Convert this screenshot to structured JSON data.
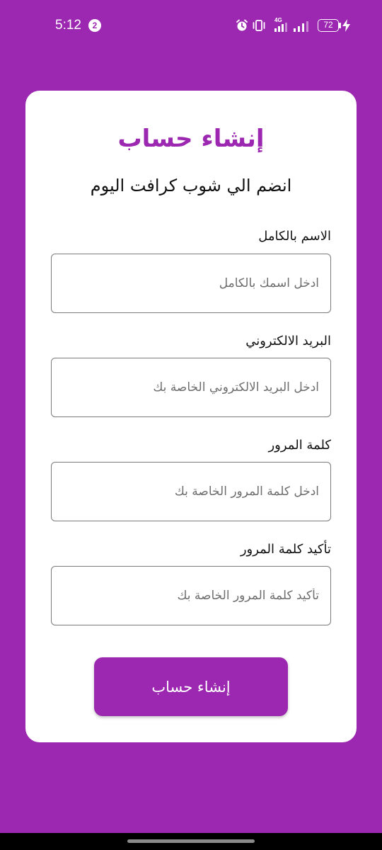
{
  "status_bar": {
    "time": "5:12",
    "notification_count": "2",
    "network_type": "4G",
    "battery_level": "72",
    "icons": [
      "alarm-icon",
      "vibrate-icon",
      "signal-icon",
      "signal-icon",
      "battery-icon",
      "charging-icon"
    ]
  },
  "colors": {
    "background": "#9c27b0",
    "accent": "#9c27b0",
    "card": "#ffffff"
  },
  "form": {
    "title": "إنشاء حساب",
    "subtitle": "انضم الي شوب كرافت اليوم",
    "fields": [
      {
        "label": "الاسم بالكامل",
        "placeholder": "ادخل اسمك بالكامل",
        "value": ""
      },
      {
        "label": "البريد الالكتروني",
        "placeholder": "ادخل البريد الالكتروني الخاصة بك",
        "value": ""
      },
      {
        "label": "كلمة المرور",
        "placeholder": "ادخل كلمة المرور الخاصة بك",
        "value": ""
      },
      {
        "label": "تأكيد كلمة المرور",
        "placeholder": "تأكيد كلمة المرور الخاصة بك",
        "value": ""
      }
    ],
    "submit_label": "إنشاء حساب"
  }
}
